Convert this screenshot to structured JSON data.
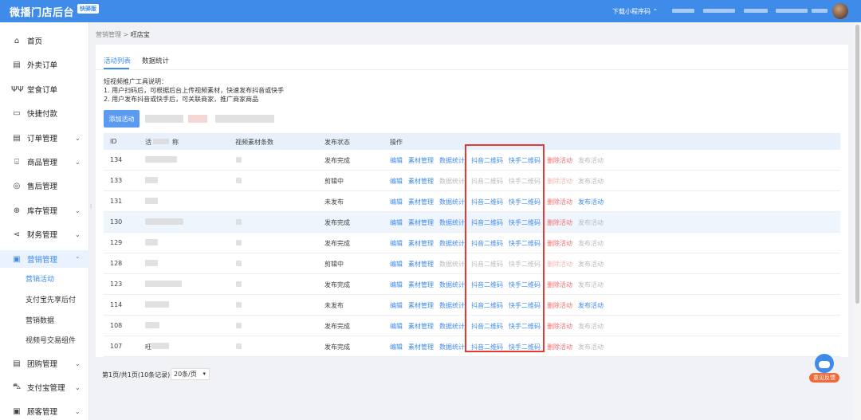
{
  "header": {
    "brand": "微播门店后台",
    "badge": "快驿版",
    "mini_program": "下载小程序码 ⌃"
  },
  "sidebar": {
    "items": [
      {
        "label": "首页",
        "icon": "home-icon",
        "glyph": "⌂"
      },
      {
        "label": "外卖订单",
        "icon": "delivery-order-icon",
        "glyph": "▤"
      },
      {
        "label": "堂食订单",
        "icon": "dine-in-icon",
        "glyph": "ΨΨ"
      },
      {
        "label": "快捷付款",
        "icon": "quick-pay-icon",
        "glyph": "▭"
      },
      {
        "label": "订单管理",
        "icon": "order-manage-icon",
        "glyph": "▤",
        "arrow": "⌄"
      },
      {
        "label": "商品管理",
        "icon": "goods-icon",
        "glyph": "⌺",
        "arrow": "⌄"
      },
      {
        "label": "售后管理",
        "icon": "after-sale-icon",
        "glyph": "◎"
      },
      {
        "label": "库存管理",
        "icon": "inventory-icon",
        "glyph": "⊕",
        "arrow": "⌄"
      },
      {
        "label": "财务管理",
        "icon": "finance-icon",
        "glyph": "⋖",
        "arrow": "⌄"
      },
      {
        "label": "营销管理",
        "icon": "marketing-icon",
        "glyph": "▣",
        "arrow": "⌃"
      },
      {
        "label": "团购管理",
        "icon": "group-buy-icon",
        "glyph": "▤",
        "arrow": "⌄"
      },
      {
        "label": "支付宝管理",
        "icon": "alipay-icon",
        "glyph": "⛍",
        "arrow": "⌄"
      },
      {
        "label": "顾客管理",
        "icon": "customer-icon",
        "glyph": "▣",
        "arrow": "⌄"
      }
    ],
    "subitems": [
      "营销活动",
      "支付宝先享后付",
      "营销数据",
      "视频号交易组件"
    ]
  },
  "breadcrumb": {
    "parent": "营销管理",
    "sep": ">",
    "current": "旺店宝"
  },
  "tabs": [
    "活动列表",
    "数据统计"
  ],
  "description": [
    "短视频推广工具说明：",
    "1. 用户扫码后，可根据后台上传视频素材，快速发布抖音或快手",
    "2. 用户发布抖音或快手后，可关联商家，推广商家商品"
  ],
  "add_button": "添加活动",
  "table": {
    "headers": [
      "ID",
      "活动名称",
      "视频素材条数",
      "发布状态",
      "操作"
    ],
    "header_activity_visible": "活",
    "header_activity_tail": "称",
    "actions": [
      "编辑",
      "素材管理",
      "数据统计",
      "抖音二维码",
      "快手二维码",
      "删除活动",
      "发布活动"
    ],
    "rows": [
      {
        "id": "134",
        "name": "",
        "status": "发布完成"
      },
      {
        "id": "133",
        "name": "",
        "status": "剪辑中"
      },
      {
        "id": "131",
        "name": "",
        "status": "未发布"
      },
      {
        "id": "130",
        "name": "",
        "status": "发布完成"
      },
      {
        "id": "129",
        "name": "",
        "status": "发布完成"
      },
      {
        "id": "128",
        "name": "",
        "status": "剪辑中"
      },
      {
        "id": "123",
        "name": "",
        "status": "发布完成"
      },
      {
        "id": "114",
        "name": "",
        "status": "未发布"
      },
      {
        "id": "108",
        "name": "",
        "status": "发布完成"
      },
      {
        "id": "107",
        "name": "旺",
        "status": "发布完成"
      }
    ]
  },
  "pager": {
    "summary": "第1页/共1页(10条记录)",
    "page_size": "20条/页",
    "caret": "▾"
  },
  "feedback": {
    "label": "意见反馈"
  },
  "colors": {
    "primary": "#3f8be9",
    "danger": "#f56c6c",
    "highlight_box": "#e53935"
  }
}
